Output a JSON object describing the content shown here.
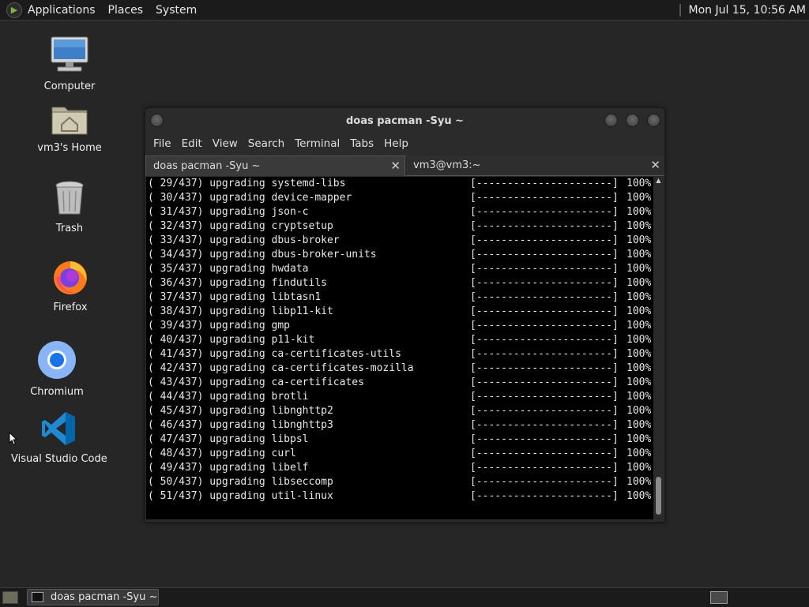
{
  "top_panel": {
    "menus": [
      "Applications",
      "Places",
      "System"
    ],
    "clock": "Mon Jul 15, 10:56 AM"
  },
  "desktop": {
    "icons": [
      {
        "label": "Computer",
        "icon": "computer-icon"
      },
      {
        "label": "vm3's Home",
        "icon": "home-folder-icon"
      },
      {
        "label": "Trash",
        "icon": "trash-icon"
      },
      {
        "label": "Firefox",
        "icon": "firefox-icon"
      },
      {
        "label": "Chromium",
        "icon": "chromium-icon"
      },
      {
        "label": "Visual Studio Code",
        "icon": "vscode-icon"
      }
    ]
  },
  "terminal": {
    "title": "doas pacman -Syu ~",
    "menus": [
      "File",
      "Edit",
      "View",
      "Search",
      "Terminal",
      "Tabs",
      "Help"
    ],
    "tabs": [
      {
        "label": "doas pacman -Syu ~",
        "close": "✕"
      },
      {
        "label": "vm3@vm3:~",
        "close": "✕"
      }
    ],
    "lines": [
      {
        "text": "( 29/437) upgrading systemd-libs",
        "bar": "[----------------------]",
        "pct": "100%"
      },
      {
        "text": "( 30/437) upgrading device-mapper",
        "bar": "[----------------------]",
        "pct": "100%"
      },
      {
        "text": "( 31/437) upgrading json-c",
        "bar": "[----------------------]",
        "pct": "100%"
      },
      {
        "text": "( 32/437) upgrading cryptsetup",
        "bar": "[----------------------]",
        "pct": "100%"
      },
      {
        "text": "( 33/437) upgrading dbus-broker",
        "bar": "[----------------------]",
        "pct": "100%"
      },
      {
        "text": "( 34/437) upgrading dbus-broker-units",
        "bar": "[----------------------]",
        "pct": "100%"
      },
      {
        "text": "( 35/437) upgrading hwdata",
        "bar": "[----------------------]",
        "pct": "100%"
      },
      {
        "text": "( 36/437) upgrading findutils",
        "bar": "[----------------------]",
        "pct": "100%"
      },
      {
        "text": "( 37/437) upgrading libtasn1",
        "bar": "[----------------------]",
        "pct": "100%"
      },
      {
        "text": "( 38/437) upgrading libp11-kit",
        "bar": "[----------------------]",
        "pct": "100%"
      },
      {
        "text": "( 39/437) upgrading gmp",
        "bar": "[----------------------]",
        "pct": "100%"
      },
      {
        "text": "( 40/437) upgrading p11-kit",
        "bar": "[----------------------]",
        "pct": "100%"
      },
      {
        "text": "( 41/437) upgrading ca-certificates-utils",
        "bar": "[----------------------]",
        "pct": "100%"
      },
      {
        "text": "( 42/437) upgrading ca-certificates-mozilla",
        "bar": "[----------------------]",
        "pct": "100%"
      },
      {
        "text": "( 43/437) upgrading ca-certificates",
        "bar": "[----------------------]",
        "pct": "100%"
      },
      {
        "text": "( 44/437) upgrading brotli",
        "bar": "[----------------------]",
        "pct": "100%"
      },
      {
        "text": "( 45/437) upgrading libnghttp2",
        "bar": "[----------------------]",
        "pct": "100%"
      },
      {
        "text": "( 46/437) upgrading libnghttp3",
        "bar": "[----------------------]",
        "pct": "100%"
      },
      {
        "text": "( 47/437) upgrading libpsl",
        "bar": "[----------------------]",
        "pct": "100%"
      },
      {
        "text": "( 48/437) upgrading curl",
        "bar": "[----------------------]",
        "pct": "100%"
      },
      {
        "text": "( 49/437) upgrading libelf",
        "bar": "[----------------------]",
        "pct": "100%"
      },
      {
        "text": "( 50/437) upgrading libseccomp",
        "bar": "[----------------------]",
        "pct": "100%"
      },
      {
        "text": "( 51/437) upgrading util-linux",
        "bar": "[----------------------]",
        "pct": "100%"
      }
    ]
  },
  "taskbar": {
    "window_button": "doas pacman -Syu ~"
  }
}
